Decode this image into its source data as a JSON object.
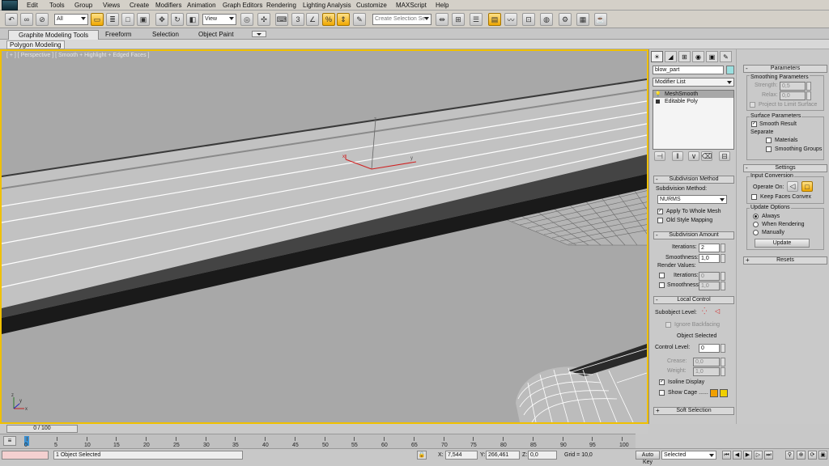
{
  "menubar": {
    "items": [
      "Edit",
      "Tools",
      "Group",
      "Views",
      "Create",
      "Modifiers",
      "Animation",
      "Graph Editors",
      "Rendering",
      "Lighting Analysis",
      "Customize",
      "MAXScript",
      "Help"
    ]
  },
  "toolbar": {
    "filter_value": "All",
    "coord_value": "View",
    "snap_value": "3",
    "selection_set_placeholder": "Create Selection Se"
  },
  "ribbon": {
    "tabs": [
      "Graphite Modeling Tools",
      "Freeform",
      "Selection",
      "Object Paint"
    ],
    "active_tab": "Graphite Modeling Tools",
    "sub_label": "Polygon Modeling"
  },
  "viewport": {
    "label": "[ + ] [ Perspective ] [ Smooth + Highlight + Edged Faces ]",
    "gizmo_labels": {
      "z": "z",
      "x": "x",
      "y": "y"
    },
    "axis_labels": {
      "x": "x",
      "y": "y",
      "z": "z"
    },
    "selection_color": "#f0c000"
  },
  "command_panel": {
    "object_name": "blow_part",
    "object_color": "#9be0e0",
    "modifier_list_label": "Modifier List",
    "stack": [
      {
        "label": "MeshSmooth",
        "selected": true
      },
      {
        "label": "Editable Poly",
        "selected": false
      }
    ],
    "subdivision_method": {
      "title": "Subdivision Method",
      "method_label": "Subdivision Method:",
      "method_value": "NURMS",
      "apply_whole_mesh": "Apply To Whole Mesh",
      "old_style": "Old Style Mapping"
    },
    "subdivision_amount": {
      "title": "Subdivision Amount",
      "iterations_label": "Iterations:",
      "iterations_value": "2",
      "smoothness_label": "Smoothness:",
      "smoothness_value": "1,0",
      "render_values": "Render Values:",
      "r_iterations_label": "Iterations:",
      "r_iterations_value": "0",
      "r_smoothness_label": "Smoothness:",
      "r_smoothness_value": "1,0"
    },
    "local_control": {
      "title": "Local Control",
      "subobject_label": "Subobject Level:",
      "ignore_backfacing": "Ignore Backfacing",
      "object_selected": "Object Selected",
      "control_level_label": "Control Level:",
      "control_level_value": "0",
      "crease_label": "Crease:",
      "crease_value": "0,0",
      "weight_label": "Weight:",
      "weight_value": "1,0",
      "isoline_display": "Isoline Display",
      "show_cage": "Show Cage ......",
      "cage_color1": "#f0a000",
      "cage_color2": "#f0d000"
    },
    "soft_selection": {
      "title": "Soft Selection"
    }
  },
  "right_panel": {
    "parameters_title": "Parameters",
    "smoothing_params": "Smoothing Parameters",
    "strength_label": "Strength:",
    "strength_value": "0,5",
    "relax_label": "Relax:",
    "relax_value": "0,0",
    "project_label": "Project to Limit Surface",
    "surface_params": "Surface Parameters",
    "smooth_result": "Smooth Result",
    "separate": "Separate",
    "materials": "Materials",
    "smoothing_groups": "Smoothing Groups",
    "settings_title": "Settings",
    "input_conversion": "Input Conversion",
    "operate_on": "Operate On:",
    "keep_faces_convex": "Keep Faces Convex",
    "update_options": "Update Options",
    "always": "Always",
    "when_rendering": "When Rendering",
    "manually": "Manually",
    "update_button": "Update",
    "resets_title": "Resets"
  },
  "timeline": {
    "frame_label": "0 / 100",
    "ticks": [
      "0",
      "5",
      "10",
      "15",
      "20",
      "25",
      "30",
      "35",
      "40",
      "45",
      "50",
      "55",
      "60",
      "65",
      "70",
      "75",
      "80",
      "85",
      "90",
      "95",
      "100"
    ]
  },
  "status": {
    "selected_text": "1 Object Selected",
    "x_label": "X:",
    "x_value": "7,544",
    "y_label": "Y:",
    "y_value": "266,461",
    "z_label": "Z:",
    "z_value": "0,0",
    "grid_text": "Grid = 10,0",
    "auto_key": "Auto Key",
    "key_mode_value": "Selected"
  }
}
